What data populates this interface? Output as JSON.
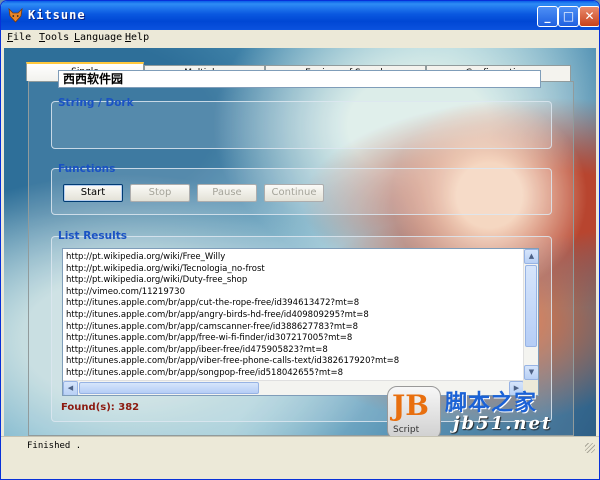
{
  "window": {
    "title": "Kitsune"
  },
  "menu": [
    "File",
    "Tools",
    "Language",
    "Help"
  ],
  "tabs": [
    "Single",
    "Multiples",
    "Engines of Search",
    "Configurations"
  ],
  "string_group": {
    "label": "String / Dork",
    "value": "西西软件园"
  },
  "functions_group": {
    "label": "Functions",
    "buttons": {
      "start": "Start",
      "stop": "Stop",
      "pause": "Pause",
      "continue": "Continue"
    }
  },
  "results_group": {
    "label": "List Results",
    "items": [
      "http://pt.wikipedia.org/wiki/Free_Willy",
      "http://pt.wikipedia.org/wiki/Tecnologia_no-frost",
      "http://pt.wikipedia.org/wiki/Duty-free_shop",
      "http://vimeo.com/11219730",
      "http://itunes.apple.com/br/app/cut-the-rope-free/id394613472?mt=8",
      "http://itunes.apple.com/br/app/angry-birds-hd-free/id409809295?mt=8",
      "http://itunes.apple.com/br/app/camscanner-free/id388627783?mt=8",
      "http://itunes.apple.com/br/app/free-wi-fi-finder/id307217005?mt=8",
      "http://itunes.apple.com/br/app/ibeer-free/id475905823?mt=8",
      "http://itunes.apple.com/br/app/viber-free-phone-calls-text/id382617920?mt=8",
      "http://itunes.apple.com/br/app/songpop-free/id518042655?mt=8"
    ],
    "found_label": "Found(s): 382"
  },
  "watermark": {
    "letters": "JB",
    "script": "Script",
    "cn": "脚本之家",
    "url": "jb51.net"
  },
  "status": {
    "text": "Finished ."
  },
  "colors": {
    "titlebar": "#0a58e0",
    "group_label": "#1a52c4",
    "found": "#8c1a10",
    "tab_highlight": "#ffc83c"
  },
  "icons": {
    "app": "fox-icon",
    "minimize": "minimize-icon",
    "maximize": "maximize-icon",
    "close": "close-icon"
  }
}
